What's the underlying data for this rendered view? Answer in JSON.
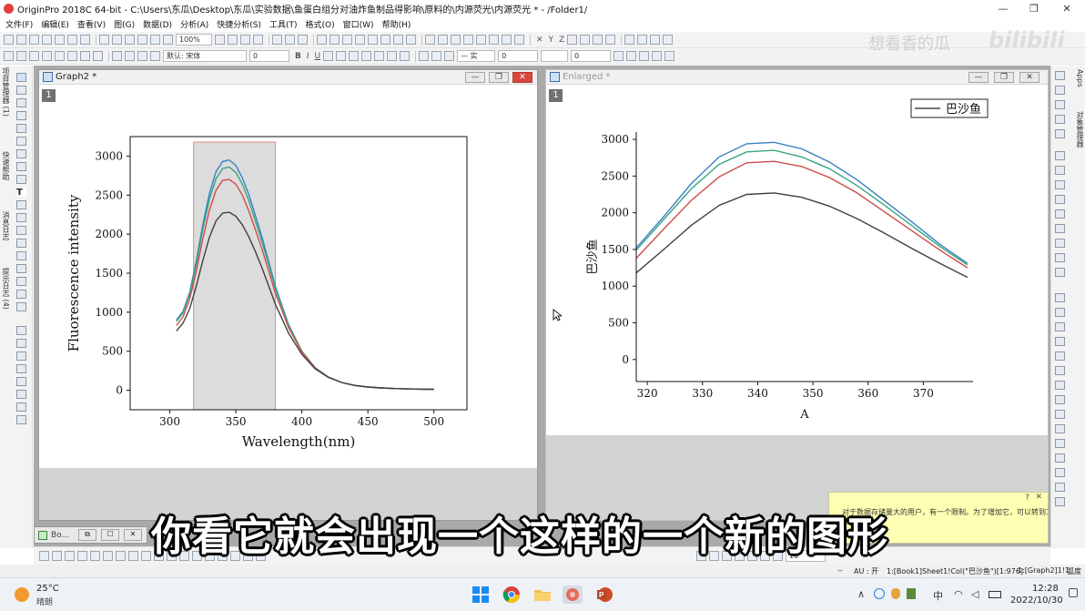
{
  "titlebar": {
    "title": "OriginPro 2018C 64-bit - C:\\Users\\东瓜\\Desktop\\东瓜\\实验数据\\鱼蛋白组分对油炸鱼制品得影响\\原料的\\内源荧光\\内源荧光 * - /Folder1/",
    "minimize": "—",
    "restore": "❐",
    "close": "✕"
  },
  "menu": [
    "文件(F)",
    "编辑(E)",
    "查看(V)",
    "图(G)",
    "数据(D)",
    "分析(A)",
    "快捷分析(S)",
    "工具(T)",
    "格式(O)",
    "窗口(W)",
    "帮助(H)"
  ],
  "toolbar": {
    "zoom_value": "100%",
    "font_value": "默认: 宋体",
    "fontsize_value": "0",
    "bold": "B",
    "italic": "I",
    "underline": "U",
    "line_width": "0",
    "line_width2": "0"
  },
  "left_tabs": [
    "项目管理器 (1)",
    "快速帮助",
    "消息日志",
    "提示日志 (4)"
  ],
  "right_tabs": [
    "Apps",
    "对象管理器"
  ],
  "graph2": {
    "title": "Graph2 *",
    "layer": "1",
    "chart_data": {
      "type": "line",
      "xlabel": "Wavelength(nm)",
      "ylabel": "Fluorescence intensity",
      "xlim": [
        270,
        525
      ],
      "ylim": [
        -250,
        3250
      ],
      "xticks": [
        "300",
        "350",
        "400",
        "450",
        "500"
      ],
      "yticks": [
        "0",
        "500",
        "1000",
        "1500",
        "2000",
        "2500",
        "3000"
      ],
      "selection_range": [
        318,
        380
      ],
      "x": [
        305,
        310,
        315,
        320,
        325,
        330,
        335,
        340,
        345,
        350,
        355,
        360,
        365,
        370,
        375,
        380,
        390,
        400,
        410,
        420,
        430,
        440,
        450,
        460,
        470,
        480,
        490,
        500
      ],
      "series": [
        {
          "color": "#3a7fc1",
          "values": [
            900,
            1010,
            1250,
            1650,
            2120,
            2520,
            2800,
            2930,
            2950,
            2880,
            2720,
            2500,
            2230,
            1950,
            1640,
            1330,
            840,
            500,
            290,
            170,
            100,
            62,
            42,
            30,
            22,
            17,
            14,
            12
          ]
        },
        {
          "color": "#3aa582",
          "values": [
            880,
            990,
            1220,
            1610,
            2060,
            2450,
            2710,
            2840,
            2860,
            2790,
            2640,
            2420,
            2160,
            1890,
            1600,
            1300,
            830,
            500,
            290,
            170,
            100,
            62,
            42,
            30,
            22,
            17,
            14,
            12
          ]
        },
        {
          "color": "#d04b4b",
          "values": [
            830,
            940,
            1160,
            1520,
            1940,
            2310,
            2560,
            2690,
            2700,
            2640,
            2500,
            2290,
            2050,
            1800,
            1520,
            1240,
            800,
            490,
            285,
            168,
            100,
            62,
            42,
            30,
            22,
            17,
            14,
            12
          ]
        },
        {
          "color": "#404040",
          "values": [
            760,
            860,
            1040,
            1330,
            1660,
            1960,
            2170,
            2270,
            2280,
            2230,
            2120,
            1960,
            1770,
            1560,
            1330,
            1100,
            730,
            460,
            275,
            165,
            100,
            62,
            42,
            30,
            22,
            17,
            14,
            12
          ]
        }
      ]
    }
  },
  "enlarged": {
    "title": "Enlarged *",
    "layer": "1",
    "legend": "巴沙鱼",
    "chart_data": {
      "type": "line",
      "xlabel": "A",
      "ylabel": "巴沙鱼",
      "xlim": [
        318,
        379
      ],
      "ylim": [
        -300,
        3100
      ],
      "xticks": [
        "320",
        "330",
        "340",
        "350",
        "360",
        "370"
      ],
      "yticks": [
        "0",
        "500",
        "1000",
        "1500",
        "2000",
        "2500",
        "3000"
      ],
      "x": [
        318,
        323,
        328,
        333,
        338,
        343,
        348,
        353,
        358,
        363,
        368,
        373,
        378
      ],
      "series": [
        {
          "color": "#3a7fc1",
          "values": [
            1520,
            1950,
            2400,
            2760,
            2940,
            2960,
            2870,
            2690,
            2450,
            2160,
            1870,
            1570,
            1310
          ]
        },
        {
          "color": "#3aa582",
          "values": [
            1490,
            1910,
            2330,
            2660,
            2830,
            2850,
            2760,
            2600,
            2370,
            2100,
            1820,
            1540,
            1290
          ]
        },
        {
          "color": "#d04b4b",
          "values": [
            1380,
            1780,
            2170,
            2490,
            2680,
            2700,
            2630,
            2480,
            2270,
            2010,
            1750,
            1490,
            1250
          ]
        },
        {
          "color": "#404040",
          "values": [
            1180,
            1500,
            1830,
            2100,
            2250,
            2270,
            2210,
            2090,
            1920,
            1720,
            1510,
            1310,
            1120
          ]
        }
      ]
    }
  },
  "minimized": {
    "label": "Bo..."
  },
  "bottom_toolbar": {
    "size_value": "10"
  },
  "status": {
    "separator": "--",
    "au": "AU : 开",
    "info": "1:[Book1]Sheet1!Col(\"巴沙鱼\")[1:976]",
    "graph": "1:[Graph2]1!1",
    "unit": "弧度"
  },
  "tooltip": {
    "text": "对于数据存储量大的用户，有一个限制。为了增加它，可以转到工"
  },
  "subtitle": "你看它就会出现一个这样的一个新的图形",
  "watermark": "想看香的瓜",
  "bili": "bilibili",
  "taskbar": {
    "temperature": "25°C",
    "weather": "晴朗",
    "ime": "中",
    "time": "12:28",
    "date": "2022/10/30",
    "tray_up": "∧"
  }
}
